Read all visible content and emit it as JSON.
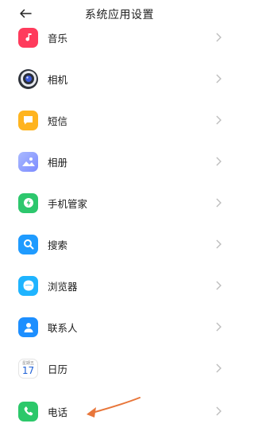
{
  "header": {
    "title": "系统应用设置",
    "back_icon": "back-arrow-icon"
  },
  "apps": [
    {
      "label": "音乐",
      "icon": "music-icon",
      "color": "#ff3b5c"
    },
    {
      "label": "相机",
      "icon": "camera-icon",
      "color": "#3a3f4a"
    },
    {
      "label": "短信",
      "icon": "message-icon",
      "color": "#ffb41f"
    },
    {
      "label": "相册",
      "icon": "gallery-icon",
      "color": "#8fa6ff"
    },
    {
      "label": "手机管家",
      "icon": "shield-icon",
      "color": "#2dc76d"
    },
    {
      "label": "搜索",
      "icon": "search-icon",
      "color": "#1f9bff"
    },
    {
      "label": "浏览器",
      "icon": "browser-icon",
      "color": "#1fb4ff"
    },
    {
      "label": "联系人",
      "icon": "contacts-icon",
      "color": "#1d8fff"
    },
    {
      "label": "日历",
      "icon": "calendar-icon",
      "color": "#ffffff",
      "day": "17",
      "weekday": "星期五"
    },
    {
      "label": "电话",
      "icon": "phone-icon",
      "color": "#2cc86a"
    }
  ],
  "annotation": {
    "icon": "orange-arrow-icon",
    "color": "#e8763a"
  }
}
